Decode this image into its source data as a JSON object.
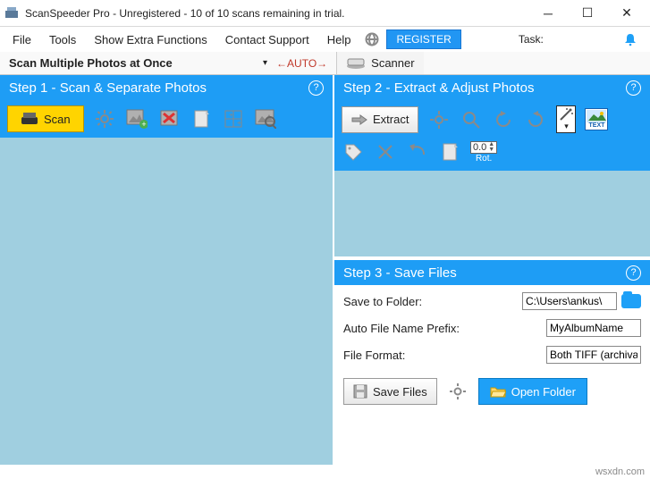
{
  "title": "ScanSpeeder Pro - Unregistered - 10 of 10 scans remaining in trial.",
  "menu": {
    "file": "File",
    "tools": "Tools",
    "extra": "Show Extra Functions",
    "contact": "Contact Support",
    "help": "Help",
    "register": "REGISTER",
    "task": "Task:"
  },
  "mode": "Scan Multiple Photos at Once",
  "auto": "←AUTO→",
  "scanner_tab": "Scanner",
  "step1": {
    "title": "Step 1 - Scan & Separate Photos",
    "scan": "Scan"
  },
  "step2": {
    "title": "Step 2 - Extract & Adjust Photos",
    "extract": "Extract",
    "rot_val": "0.0",
    "rot_label": "Rot.",
    "text_icon": "TEXT"
  },
  "step3": {
    "title": "Step 3 - Save Files",
    "save_to": "Save to Folder:",
    "prefix": "Auto File Name Prefix:",
    "format": "File Format:",
    "folder_val": "C:\\Users\\ankus\\",
    "prefix_val": "MyAlbumName",
    "format_val": "Both TIFF (archival",
    "save_btn": "Save Files",
    "open_btn": "Open Folder"
  },
  "footer": "wsxdn.com"
}
